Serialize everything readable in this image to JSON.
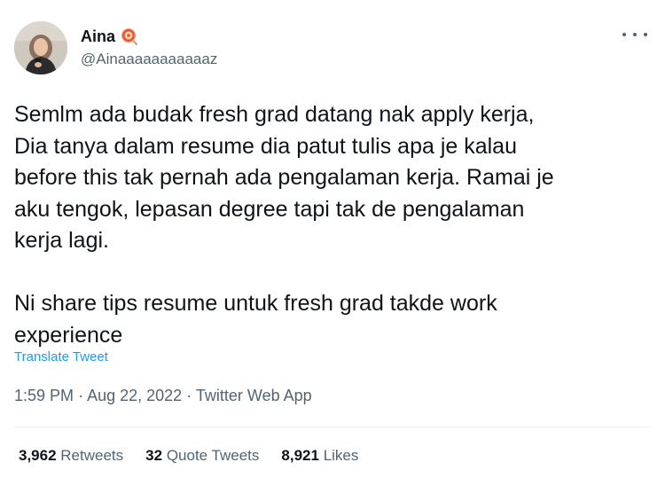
{
  "author": {
    "display_name": "Aina",
    "name_emoji": "lollipop-icon",
    "handle": "@Ainaaaaaaaaaaaz"
  },
  "more_icon": "more-horizontal-icon",
  "tweet": {
    "paragraphs": [
      "Semlm ada budak fresh grad datang nak apply kerja,\nDia tanya dalam resume dia patut tulis apa je kalau\nbefore this tak pernah ada pengalaman kerja. Ramai je\naku tengok, lepasan degree tapi tak de pengalaman\nkerja lagi.",
      "Ni share tips resume untuk fresh grad takde work\nexperience"
    ]
  },
  "translate_label": "Translate Tweet",
  "meta": {
    "time": "1:59 PM",
    "separator": "·",
    "date": "Aug 22, 2022",
    "source": "Twitter Web App"
  },
  "stats": {
    "retweets_count": "3,962",
    "retweets_label": "Retweets",
    "quotes_count": "32",
    "quotes_label": "Quote Tweets",
    "likes_count": "8,921",
    "likes_label": "Likes"
  },
  "colors": {
    "text_primary": "#0f1419",
    "text_secondary": "#536471",
    "link": "#1d9bf0",
    "divider": "#eff3f4"
  }
}
